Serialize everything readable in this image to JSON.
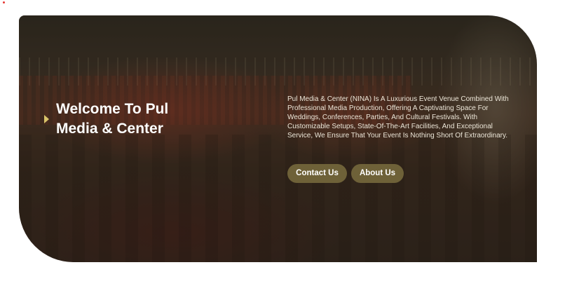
{
  "hero": {
    "title": "Welcome To Pul Media & Center",
    "description": "Pul Media & Center (NINA) Is A Luxurious Event Venue Combined With Professional Media Production, Offering A Captivating Space For Weddings, Conferences, Parties, And Cultural Festivals. With Customizable Setups, State-Of-The-Art Facilities, And Exceptional Service, We Ensure That Your Event Is Nothing Short Of Extraordinary.",
    "buttons": {
      "contact_label": "Contact Us",
      "about_label": "About Us"
    },
    "marker_icon": "play-triangle-icon",
    "colors": {
      "button_bg": "#6e6138",
      "marker": "#d9c46a",
      "overlay": "#281e12"
    }
  }
}
